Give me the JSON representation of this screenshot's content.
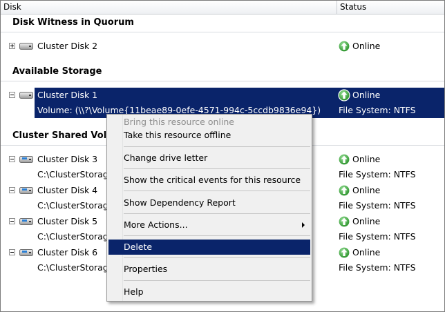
{
  "header": {
    "disk_col": "Disk",
    "status_col": "Status"
  },
  "groups": {
    "witness": "Disk Witness in Quorum",
    "available": "Available Storage",
    "csv": "Cluster Shared Volu"
  },
  "rows": {
    "disk2": {
      "label": "Cluster Disk 2",
      "status": "Online"
    },
    "disk1": {
      "label": "Cluster Disk 1",
      "status": "Online",
      "volume": "Volume: (\\\\?\\Volume{11beae89-0efe-4571-994c-5ccdb9836e94})",
      "fs": "File System: NTFS"
    },
    "disk3": {
      "label": "Cluster Disk 3",
      "status": "Online",
      "path": "C:\\ClusterStorage",
      "fs": "File System: NTFS"
    },
    "disk4": {
      "label": "Cluster Disk 4",
      "status": "Online",
      "path": "C:\\ClusterStorage",
      "fs": "File System: NTFS"
    },
    "disk5": {
      "label": "Cluster Disk 5",
      "status": "Online",
      "path": "C:\\ClusterStorage",
      "fs": "File System: NTFS"
    },
    "disk6": {
      "label": "Cluster Disk 6",
      "status": "Online",
      "path": "C:\\ClusterStorage",
      "fs": "File System: NTFS"
    }
  },
  "menu": {
    "bring_online": "Bring this resource online",
    "take_offline": "Take this resource offline",
    "change_drive": "Change drive letter",
    "critical_events": "Show the critical events for this resource",
    "dependency_report": "Show Dependency Report",
    "more_actions": "More Actions...",
    "delete": "Delete",
    "properties": "Properties",
    "help": "Help"
  },
  "colors": {
    "selection": "#0a246a",
    "online_green": "#3aa53a"
  }
}
